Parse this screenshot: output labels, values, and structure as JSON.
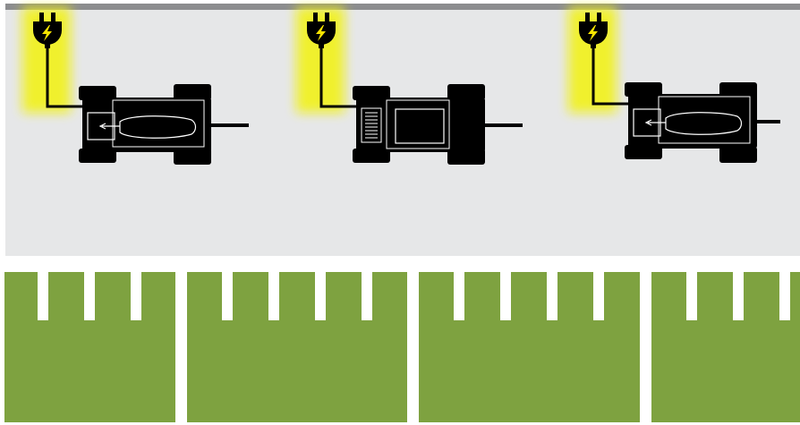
{
  "colors": {
    "page_background": "#ffffff",
    "top_rail": "#8c8d8f",
    "garage_floor": "#e6e7e8",
    "plug_glow": "#f2f20a",
    "plug_bolt": "#f7e300",
    "machine": "#000000",
    "machine_detail": "#ffffff",
    "field_green": "#7ea240",
    "field_lines": "#ffffff"
  },
  "garage": {
    "charging_stations": [
      {
        "id": "station-1",
        "icon": "power-plug-icon",
        "tractor_attachment": "harvester-head",
        "state": "charging"
      },
      {
        "id": "station-2",
        "icon": "power-plug-icon",
        "tractor_attachment": "battery-pack",
        "state": "charging"
      },
      {
        "id": "station-3",
        "icon": "power-plug-icon",
        "tractor_attachment": "harvester-head",
        "state": "charging"
      }
    ]
  },
  "field": {
    "plots": [
      {
        "id": "plot-1",
        "row_markers": 3
      },
      {
        "id": "plot-2",
        "row_markers": 4
      },
      {
        "id": "plot-3",
        "row_markers": 4
      },
      {
        "id": "plot-4",
        "row_markers": 3
      }
    ]
  }
}
